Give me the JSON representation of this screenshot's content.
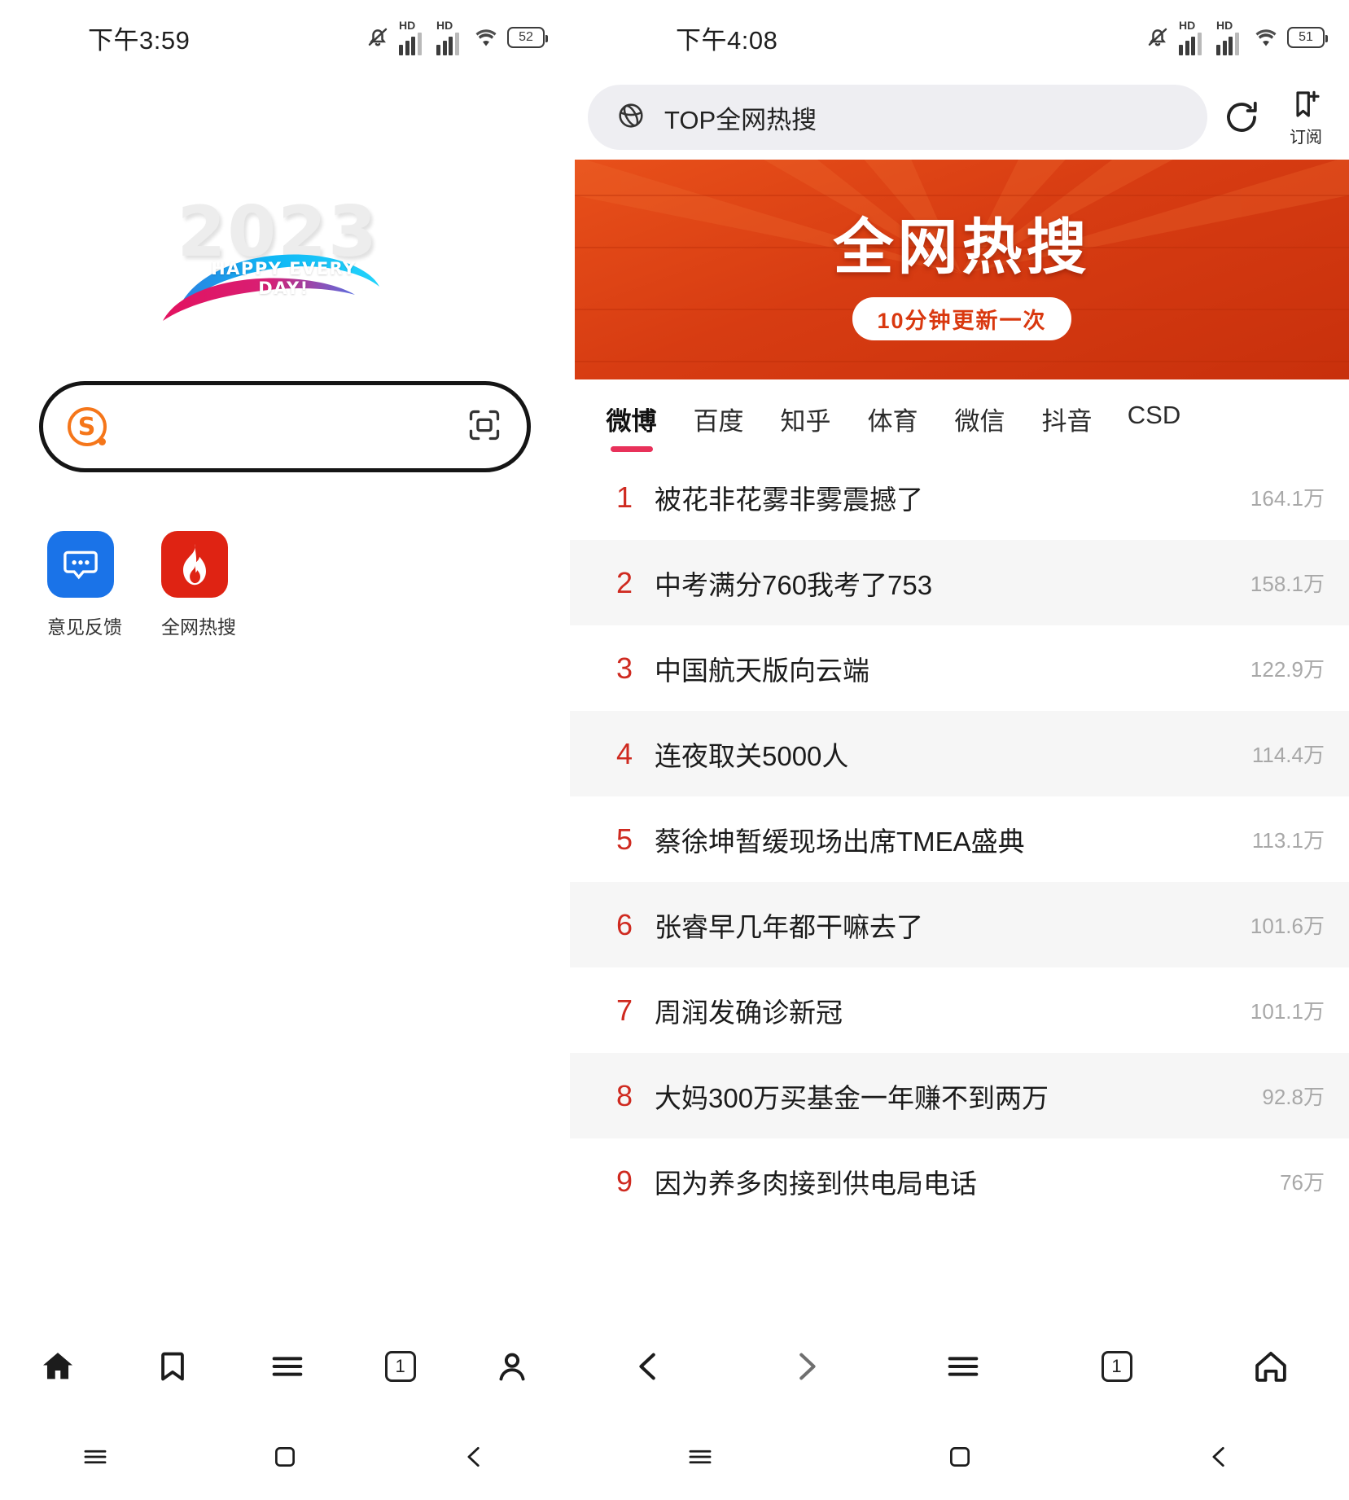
{
  "left": {
    "status": {
      "time": "下午3:59",
      "battery": "52",
      "icons": [
        "mute-icon",
        "hd-signal-icon",
        "hd-signal-icon",
        "wifi-icon",
        "battery-icon"
      ]
    },
    "logo": {
      "year": "2023",
      "tagline": "HAPPY EVERY DAY!"
    },
    "search": {
      "brand": "S",
      "placeholder": "",
      "value": "",
      "scan_icon": "scan-icon"
    },
    "shortcuts": [
      {
        "label": "意见反馈",
        "icon": "chat-bubble-icon",
        "color": "#1a73e8"
      },
      {
        "label": "全网热搜",
        "icon": "flame-icon",
        "color": "#df2313"
      }
    ],
    "toolbar": [
      {
        "name": "home",
        "icon": "home-icon"
      },
      {
        "name": "bookmark",
        "icon": "bookmark-icon"
      },
      {
        "name": "menu",
        "icon": "menu-icon"
      },
      {
        "name": "tabs",
        "icon": "tab-count-icon",
        "count": "1"
      },
      {
        "name": "profile",
        "icon": "person-icon"
      }
    ],
    "navbar": [
      {
        "name": "recents",
        "icon": "recents-icon"
      },
      {
        "name": "home",
        "icon": "square-home-icon"
      },
      {
        "name": "back",
        "icon": "back-chevron-icon"
      }
    ]
  },
  "right": {
    "status": {
      "time": "下午4:08",
      "battery": "51",
      "icons": [
        "mute-icon",
        "hd-signal-icon",
        "hd-signal-icon",
        "wifi-icon",
        "battery-icon"
      ]
    },
    "address": {
      "icon": "globe-icon",
      "text": "TOP全网热搜",
      "reload_icon": "reload-icon",
      "subscribe_icon": "bookmark-add-icon",
      "subscribe_label": "订阅"
    },
    "banner": {
      "title": "全网热搜",
      "subtitle": "10分钟更新一次"
    },
    "tabs": [
      {
        "label": "微博",
        "active": true
      },
      {
        "label": "百度",
        "active": false
      },
      {
        "label": "知乎",
        "active": false
      },
      {
        "label": "体育",
        "active": false
      },
      {
        "label": "微信",
        "active": false
      },
      {
        "label": "抖音",
        "active": false
      },
      {
        "label": "CSD",
        "active": false
      }
    ],
    "hotlist": [
      {
        "rank": "1",
        "title": "被花非花雾非雾震撼了",
        "count": "164.1万"
      },
      {
        "rank": "2",
        "title": "中考满分760我考了753",
        "count": "158.1万"
      },
      {
        "rank": "3",
        "title": "中国航天版向云端",
        "count": "122.9万"
      },
      {
        "rank": "4",
        "title": "连夜取关5000人",
        "count": "114.4万"
      },
      {
        "rank": "5",
        "title": "蔡徐坤暂缓现场出席TMEA盛典",
        "count": "113.1万"
      },
      {
        "rank": "6",
        "title": "张睿早几年都干嘛去了",
        "count": "101.6万"
      },
      {
        "rank": "7",
        "title": "周润发确诊新冠",
        "count": "101.1万"
      },
      {
        "rank": "8",
        "title": "大妈300万买基金一年赚不到两万",
        "count": "92.8万"
      },
      {
        "rank": "9",
        "title": "因为养多肉接到供电局电话",
        "count": "76万"
      }
    ],
    "toolbar": [
      {
        "name": "back",
        "icon": "back-chevron-icon"
      },
      {
        "name": "forward",
        "icon": "forward-chevron-icon"
      },
      {
        "name": "menu",
        "icon": "menu-icon"
      },
      {
        "name": "tabs",
        "icon": "tab-count-icon",
        "count": "1"
      },
      {
        "name": "home",
        "icon": "home-outline-icon"
      }
    ],
    "navbar": [
      {
        "name": "recents",
        "icon": "recents-icon"
      },
      {
        "name": "home",
        "icon": "square-home-icon"
      },
      {
        "name": "back",
        "icon": "back-chevron-icon"
      }
    ]
  }
}
